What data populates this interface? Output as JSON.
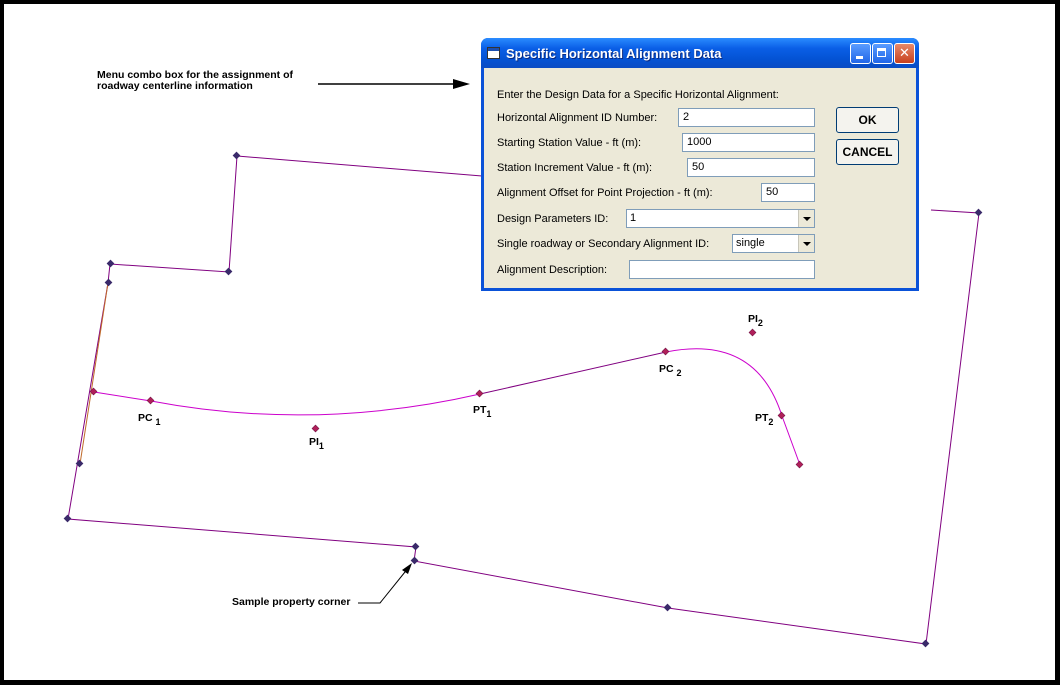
{
  "dialog": {
    "title": "Specific Horizontal Alignment Data",
    "instruction": "Enter the Design Data for a Specific Horizontal Alignment:",
    "fields": [
      {
        "label": "Horizontal Alignment ID Number:",
        "value": "2"
      },
      {
        "label": "Starting Station Value - ft (m):",
        "value": "1000"
      },
      {
        "label": "Station Increment Value - ft (m):",
        "value": "50"
      },
      {
        "label": "Alignment Offset for Point Projection - ft (m):",
        "value": "50"
      },
      {
        "label": "Design Parameters ID:",
        "value": "1"
      },
      {
        "label": "Single roadway or Secondary Alignment ID:",
        "value": "single"
      },
      {
        "label": "Alignment Description:",
        "value": ""
      }
    ],
    "ok_label": "OK",
    "cancel_label": "CANCEL"
  },
  "annotations": {
    "menu_note_line1": "Menu combo box for the assignment of",
    "menu_note_line2": "roadway centerline information",
    "property_corner_note": "Sample property corner"
  },
  "point_labels": {
    "pc1": {
      "base": "PC",
      "sub": "1"
    },
    "pi1": {
      "base": "PI",
      "sub": "1"
    },
    "pt1": {
      "base": "PT",
      "sub": "1"
    },
    "pc2": {
      "base": "PC",
      "sub": "2"
    },
    "pi2": {
      "base": "PI",
      "sub": "2"
    },
    "pt2": {
      "base": "PT",
      "sub": "2"
    }
  },
  "colors": {
    "boundary_line": "#800080",
    "boundary_segment_alt": "#c06a2a",
    "alignment_curve": "#cc00cc",
    "boundary_vertex": "#3a2a6a",
    "alignment_point": "#b0205a",
    "dialog_frame": "#0a52d8",
    "dialog_client": "#ece9d8"
  },
  "icons": [
    "window-icon",
    "minimize-icon",
    "maximize-icon",
    "close-icon",
    "dropdown-arrow-icon",
    "arrow-icon"
  ]
}
